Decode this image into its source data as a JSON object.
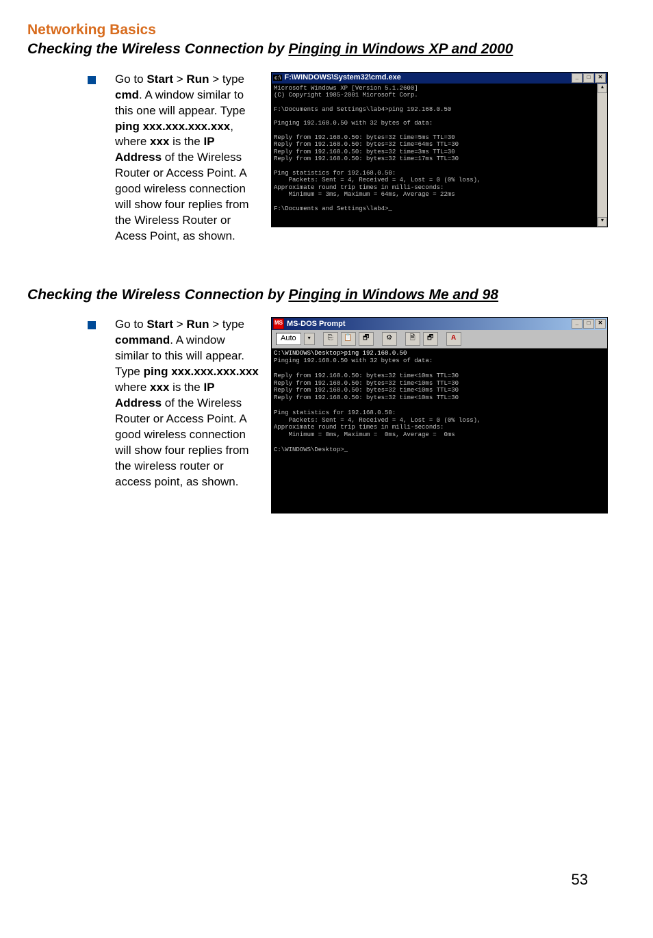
{
  "header": {
    "orange_title": "Networking Basics",
    "subtitle_plain": "Checking the Wireless Connection by ",
    "subtitle_underline": "Pinging in Windows XP and 2000"
  },
  "section_xp": {
    "instruction_parts": [
      {
        "t": "Go to "
      },
      {
        "t": "Start",
        "b": 1
      },
      {
        "t": " > "
      },
      {
        "t": "Run",
        "b": 1
      },
      {
        "t": " > type "
      },
      {
        "t": "cmd",
        "b": 1
      },
      {
        "t": ".  A window similar to this one will appear.  Type "
      },
      {
        "t": "ping xxx.xxx.xxx.xxx",
        "b": 1
      },
      {
        "t": ", where "
      },
      {
        "t": "xxx",
        "b": 1
      },
      {
        "t": " is the "
      },
      {
        "t": "IP Address",
        "b": 1
      },
      {
        "t": " of the Wireless Router or Access Point.  A good wireless connection will show four replies from the Wireless Router or Acess Point, as shown."
      }
    ],
    "window_title": "F:\\WINDOWS\\System32\\cmd.exe",
    "cmd_output": "Microsoft Windows XP [Version 5.1.2600]\n(C) Copyright 1985-2001 Microsoft Corp.\n\nF:\\Documents and Settings\\lab4>ping 192.168.0.50\n\nPinging 192.168.0.50 with 32 bytes of data:\n\nReply from 192.168.0.50: bytes=32 time=5ms TTL=30\nReply from 192.168.0.50: bytes=32 time=64ms TTL=30\nReply from 192.168.0.50: bytes=32 time=3ms TTL=30\nReply from 192.168.0.50: bytes=32 time=17ms TTL=30\n\nPing statistics for 192.168.0.50:\n    Packets: Sent = 4, Received = 4, Lost = 0 (0% loss),\nApproximate round trip times in milli-seconds:\n    Minimum = 3ms, Maximum = 64ms, Average = 22ms\n\nF:\\Documents and Settings\\lab4>_"
  },
  "header2": {
    "subtitle_plain": "Checking the Wireless Connection by ",
    "subtitle_underline": "Pinging in Windows Me and 98"
  },
  "section_98": {
    "instruction_parts": [
      {
        "t": "Go to "
      },
      {
        "t": "Start",
        "b": 1
      },
      {
        "t": " > "
      },
      {
        "t": "Run",
        "b": 1
      },
      {
        "t": " > type "
      },
      {
        "t": "command",
        "b": 1
      },
      {
        "t": ".  A window similar to this will appear.  Type "
      },
      {
        "t": "ping xxx.xxx.xxx.xxx",
        "b": 1
      },
      {
        "t": " where "
      },
      {
        "t": "xxx",
        "b": 1
      },
      {
        "t": " is the "
      },
      {
        "t": "IP Address",
        "b": 1
      },
      {
        "t": " of the Wireless Router or Access Point.  A good wireless connection will show four replies from the wireless router or access point, as shown."
      }
    ],
    "window_title": "MS-DOS Prompt",
    "toolbar_auto": "Auto",
    "toolbar_icons": [
      "⎘",
      "📋",
      "🗗",
      "⚙",
      "🗎",
      "🗗",
      "A"
    ],
    "cmd_output_white": "C:\\WINDOWS\\Desktop>ping 192.168.0.50",
    "cmd_output": "\nPinging 192.168.0.50 with 32 bytes of data:\n\nReply from 192.168.0.50: bytes=32 time<10ms TTL=30\nReply from 192.168.0.50: bytes=32 time<10ms TTL=30\nReply from 192.168.0.50: bytes=32 time<10ms TTL=30\nReply from 192.168.0.50: bytes=32 time<10ms TTL=30\n\nPing statistics for 192.168.0.50:\n    Packets: Sent = 4, Received = 4, Lost = 0 (0% loss),\nApproximate round trip times in milli-seconds:\n    Minimum = 0ms, Maximum =  0ms, Average =  0ms\n\nC:\\WINDOWS\\Desktop>_"
  },
  "page_number": "53",
  "win_btns": {
    "min": "_",
    "max": "□",
    "close": "✕",
    "up": "▴",
    "down": "▾"
  }
}
